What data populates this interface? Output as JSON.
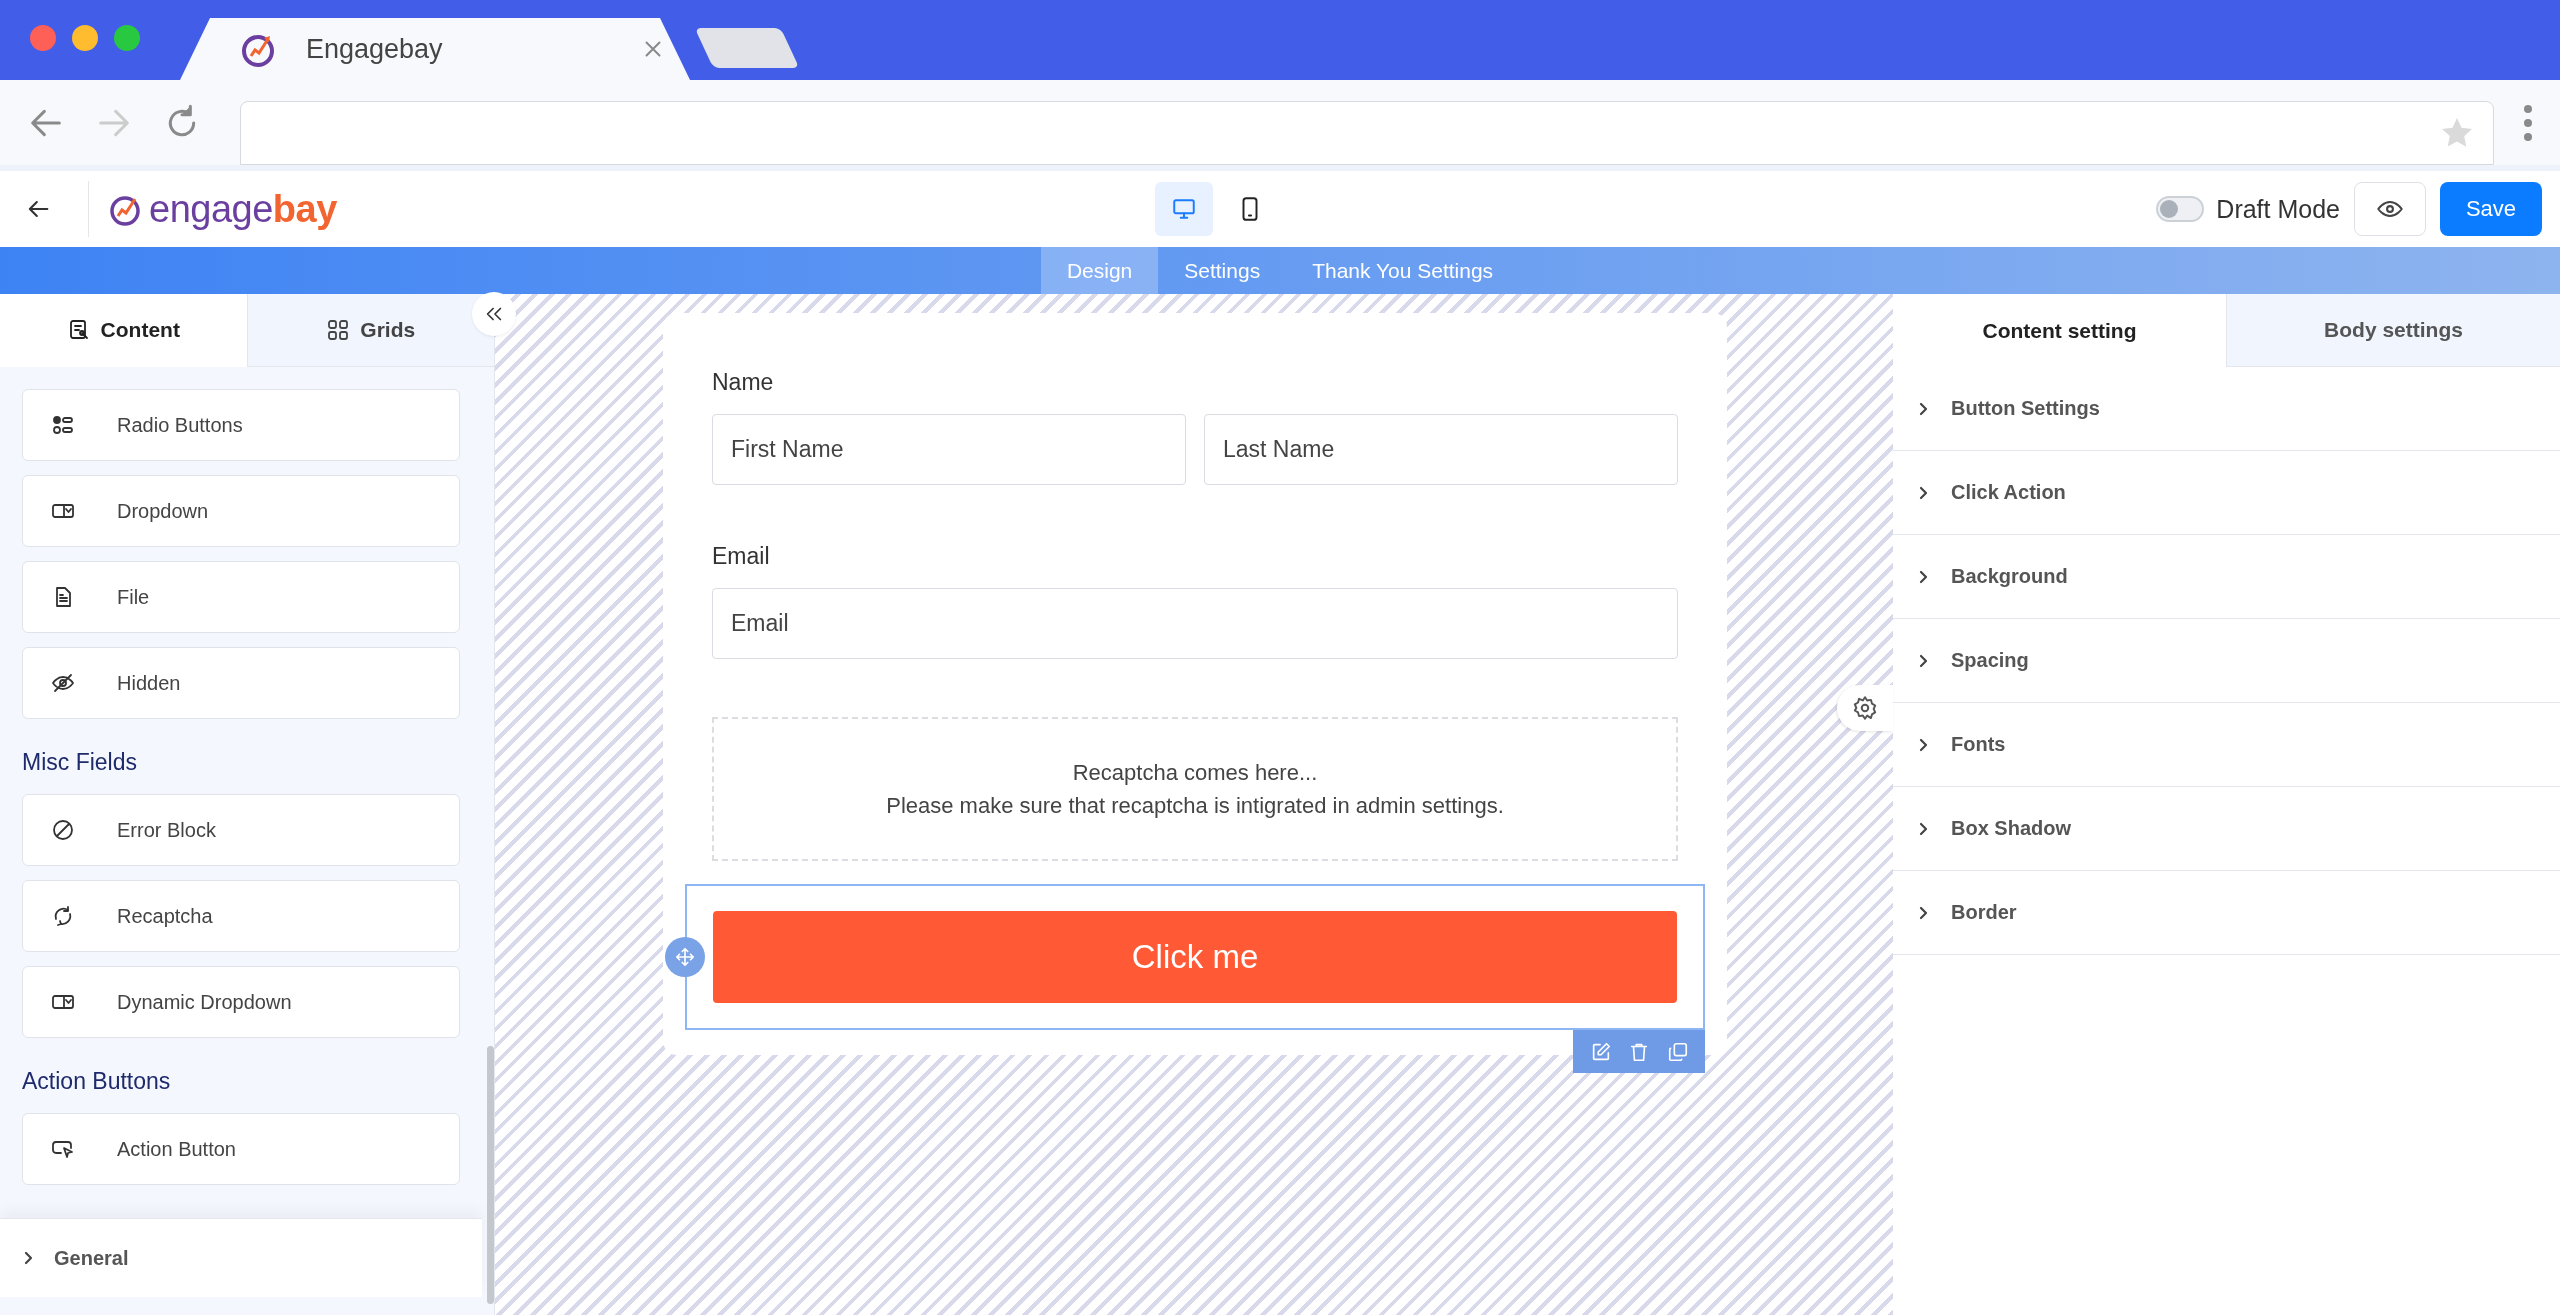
{
  "browser": {
    "tab_title": "Engagebay"
  },
  "header": {
    "logo": {
      "text": "engage",
      "accent": "bay"
    },
    "devices": [
      {
        "kind": "desktop",
        "selected": true
      },
      {
        "kind": "mobile",
        "selected": false
      }
    ],
    "draft_mode": {
      "label": "Draft Mode",
      "on": false
    },
    "save": "Save"
  },
  "nav_tabs": [
    {
      "label": "Design",
      "selected": true
    },
    {
      "label": "Settings",
      "selected": false
    },
    {
      "label": "Thank You Settings",
      "selected": false
    }
  ],
  "left_panel": {
    "tabs": [
      {
        "label": "Content",
        "kind": "content",
        "selected": true
      },
      {
        "label": "Grids",
        "kind": "grids",
        "selected": false
      }
    ],
    "groups": [
      {
        "items": [
          {
            "label": "Radio Buttons",
            "kind": "radio"
          },
          {
            "label": "Dropdown",
            "kind": "dropdown"
          },
          {
            "label": "File",
            "kind": "file"
          },
          {
            "label": "Hidden",
            "kind": "hidden"
          }
        ]
      },
      {
        "title": "Misc Fields",
        "items": [
          {
            "label": "Error Block",
            "kind": "error"
          },
          {
            "label": "Recaptcha",
            "kind": "recaptcha"
          },
          {
            "label": "Dynamic Dropdown",
            "kind": "dropdown"
          }
        ]
      },
      {
        "title": "Action Buttons",
        "items": [
          {
            "label": "Action Button",
            "kind": "action"
          }
        ]
      }
    ],
    "sections": [
      {
        "label": "General",
        "expanded": false
      }
    ]
  },
  "form": {
    "fields": [
      {
        "label": "Name",
        "inputs": [
          {
            "placeholder": "First Name"
          },
          {
            "placeholder": "Last Name"
          }
        ]
      },
      {
        "label": "Email",
        "inputs": [
          {
            "placeholder": "Email"
          }
        ]
      }
    ],
    "recaptcha": [
      "Recaptcha comes here...",
      "Please make sure that recaptcha is intigrated in admin settings."
    ],
    "button": {
      "label": "Click me",
      "selected": true
    }
  },
  "right_panel": {
    "tabs": [
      {
        "label": "Content setting",
        "selected": true
      },
      {
        "label": "Body settings",
        "selected": false
      }
    ],
    "sections": [
      {
        "label": "Button Settings",
        "expanded": false
      },
      {
        "label": "Click Action",
        "expanded": false
      },
      {
        "label": "Background",
        "expanded": false
      },
      {
        "label": "Spacing",
        "expanded": false
      },
      {
        "label": "Fonts",
        "expanded": false
      },
      {
        "label": "Box Shadow",
        "expanded": false
      },
      {
        "label": "Border",
        "expanded": false
      }
    ]
  }
}
